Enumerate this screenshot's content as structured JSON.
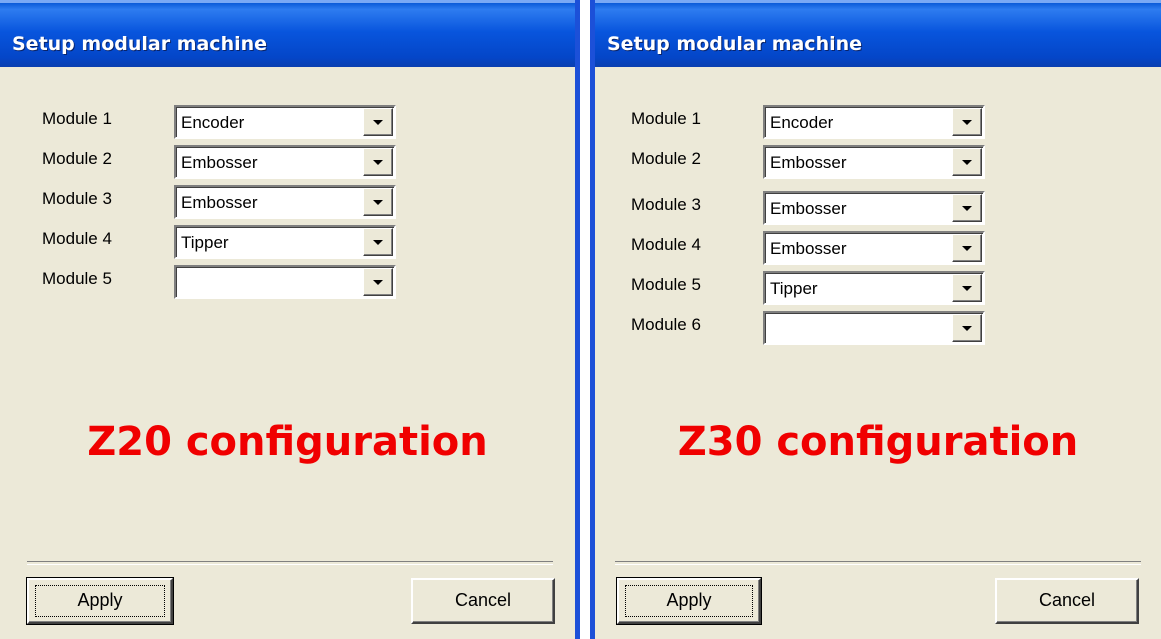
{
  "dialogs": [
    {
      "title": "Setup modular machine",
      "modules": [
        {
          "label": "Module 1",
          "value": "Encoder"
        },
        {
          "label": "Module 2",
          "value": "Embosser"
        },
        {
          "label": "Module 3",
          "value": "Embosser"
        },
        {
          "label": "Module 4",
          "value": "Tipper"
        },
        {
          "label": "Module 5",
          "value": ""
        }
      ],
      "config_title": "Z20 configuration",
      "apply_label": "Apply",
      "cancel_label": "Cancel"
    },
    {
      "title": "Setup modular machine",
      "modules": [
        {
          "label": "Module 1",
          "value": "Encoder"
        },
        {
          "label": "Module 2",
          "value": "Embosser"
        },
        {
          "label": "Module 3",
          "value": "Embosser"
        },
        {
          "label": "Module 4",
          "value": "Embosser"
        },
        {
          "label": "Module 5",
          "value": "Tipper"
        },
        {
          "label": "Module 6",
          "value": ""
        }
      ],
      "config_title": "Z30 configuration",
      "apply_label": "Apply",
      "cancel_label": "Cancel"
    }
  ],
  "colors": {
    "titlebar": "#0855dd",
    "dialog_bg": "#ece9d8",
    "config_title": "#f00000"
  }
}
